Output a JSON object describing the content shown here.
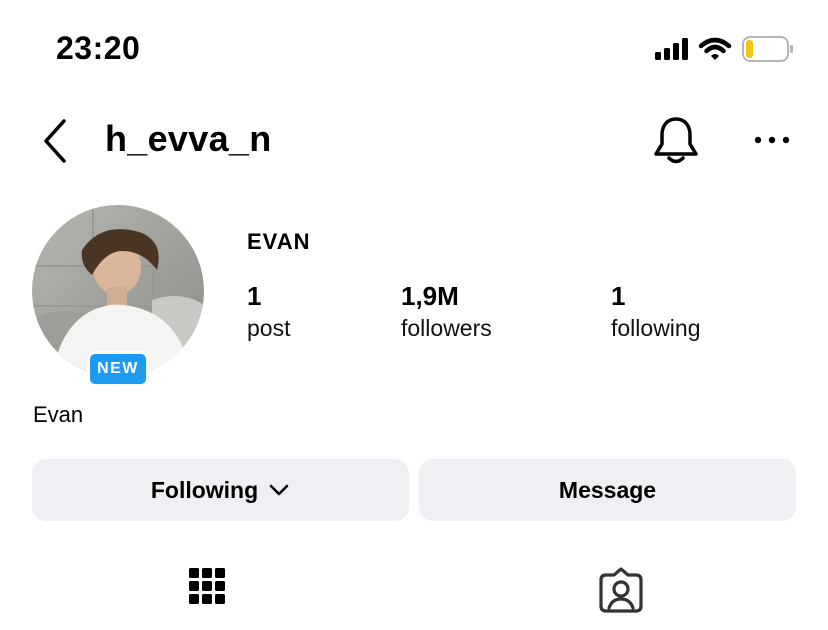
{
  "status_bar": {
    "time": "23:20",
    "icons": [
      "cellular-signal-icon",
      "wifi-icon",
      "battery-low-icon"
    ],
    "battery_color": "#f5c518"
  },
  "header": {
    "username": "h_evva_n",
    "icons": [
      "chevron-left-icon",
      "bell-icon",
      "more-horizontal-icon"
    ]
  },
  "profile": {
    "avatar_badge": "NEW",
    "badge_color": "#1d9bf0",
    "display_name": "EVAN",
    "bio_name": "Evan",
    "stats": {
      "posts": {
        "count": "1",
        "label": "post"
      },
      "followers": {
        "count": "1,9M",
        "label": "followers"
      },
      "following": {
        "count": "1",
        "label": "following"
      }
    }
  },
  "actions": {
    "following_label": "Following",
    "message_label": "Message",
    "button_bg": "#eff0f3"
  },
  "tabs": {
    "icons": [
      "grid-icon",
      "tagged-person-icon"
    ]
  }
}
